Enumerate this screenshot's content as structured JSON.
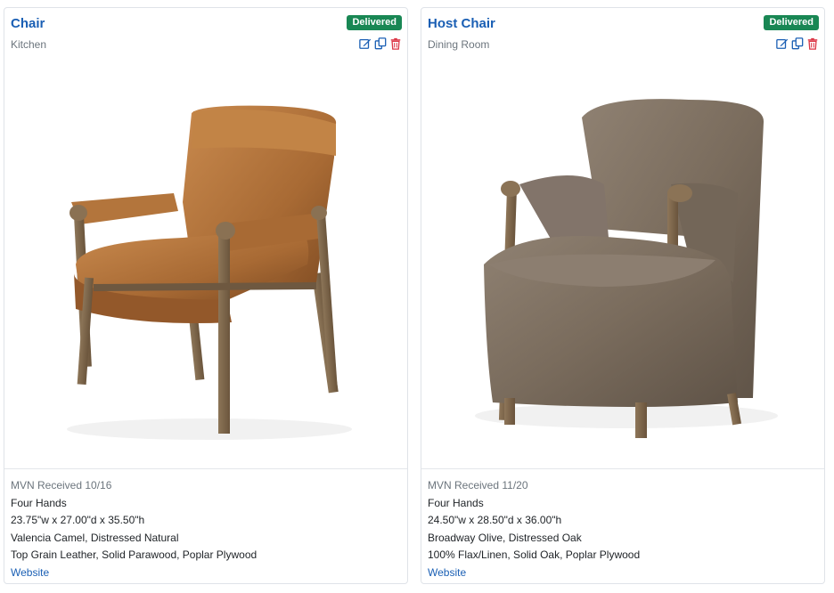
{
  "colors": {
    "link": "#1a5fb4",
    "badge_success": "#198754",
    "muted_text": "#6c757d",
    "delete_icon": "#dc3545"
  },
  "cards": [
    {
      "title": "Chair",
      "room": "Kitchen",
      "status": "Delivered",
      "image_icon": "leather-armchair-image",
      "received": "MVN Received 10/16",
      "vendor": "Four Hands",
      "dimensions": "23.75\"w x 27.00\"d x 35.50\"h",
      "finish": "Valencia Camel, Distressed Natural",
      "materials": "Top Grain Leather, Solid Parawood, Poplar Plywood",
      "link_label": "Website"
    },
    {
      "title": "Host Chair",
      "room": "Dining Room",
      "status": "Delivered",
      "image_icon": "upholstered-armchair-image",
      "received": "MVN Received 11/20",
      "vendor": "Four Hands",
      "dimensions": "24.50\"w x 28.50\"d x 36.00\"h",
      "finish": "Broadway Olive, Distressed Oak",
      "materials": "100% Flax/Linen, Solid Oak, Poplar Plywood",
      "link_label": "Website"
    }
  ]
}
